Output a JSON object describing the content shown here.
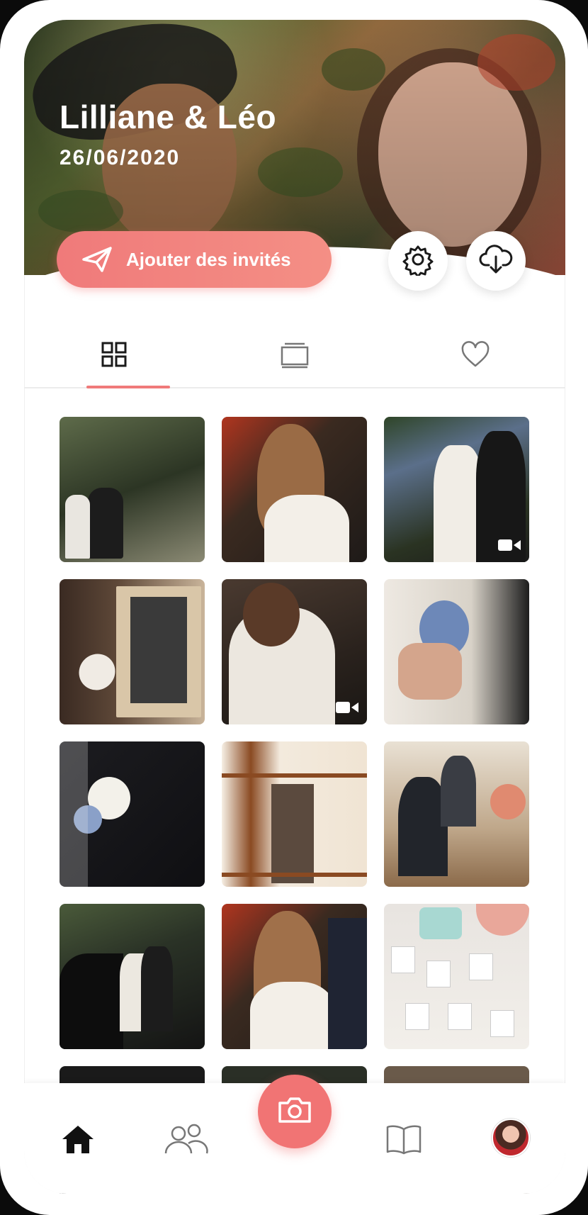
{
  "event": {
    "couple_name": "Lilliane & Léo",
    "date": "26/06/2020"
  },
  "actions": {
    "invite_label": "Ajouter des invités",
    "invite_icon": "paper-plane-icon",
    "settings_icon": "gear-icon",
    "download_icon": "cloud-download-icon"
  },
  "tabs": [
    {
      "icon": "grid-icon",
      "active": true
    },
    {
      "icon": "slideshow-icon",
      "active": false
    },
    {
      "icon": "heart-icon",
      "active": false
    }
  ],
  "photos": [
    {
      "subject": "couple-kissing-forest",
      "video": false
    },
    {
      "subject": "bride-braid-groom",
      "video": false
    },
    {
      "subject": "couple-hydrangea",
      "video": true
    },
    {
      "subject": "frame-amor",
      "video": false
    },
    {
      "subject": "bride-lace-back",
      "video": true
    },
    {
      "subject": "bride-bouquet",
      "video": false
    },
    {
      "subject": "boutonniere",
      "video": false
    },
    {
      "subject": "couple-window",
      "video": false
    },
    {
      "subject": "ceremony",
      "video": false
    },
    {
      "subject": "couple-vintage-car",
      "video": false
    },
    {
      "subject": "bride-braid-groom-2",
      "video": false
    },
    {
      "subject": "polaroids-table",
      "video": false
    }
  ],
  "colors": {
    "accent": "#f07a7a",
    "icon_dark": "#1a1a1a",
    "icon_gray": "#777777"
  },
  "bottom_nav": [
    {
      "icon": "home-icon",
      "active": true
    },
    {
      "icon": "guests-icon",
      "active": false
    },
    {
      "icon": "camera-icon",
      "active": false
    },
    {
      "icon": "book-icon",
      "active": false
    },
    {
      "icon": "avatar",
      "active": false
    }
  ]
}
